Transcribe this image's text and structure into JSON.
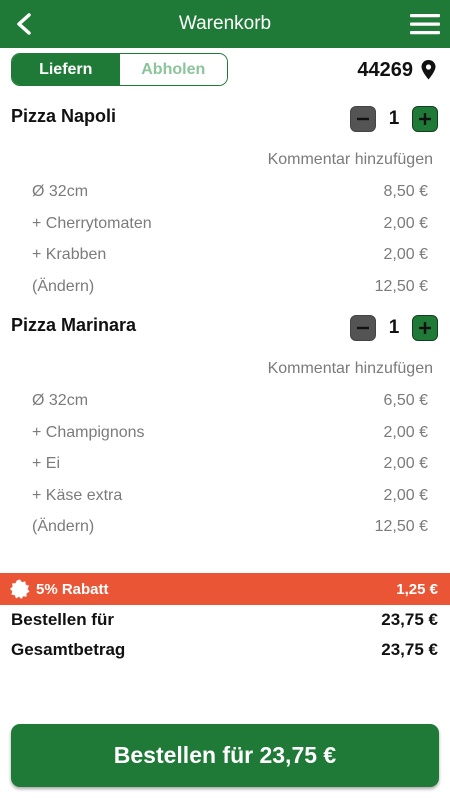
{
  "header": {
    "title": "Warenkorb",
    "back_icon": "chevron-left-icon",
    "menu_icon": "hamburger-menu-icon"
  },
  "delivery_toggle": {
    "options": [
      "Liefern",
      "Abholen"
    ],
    "selected": "Liefern"
  },
  "location": {
    "zip": "44269",
    "icon": "location-pin-icon"
  },
  "cart": [
    {
      "name": "Pizza Napoli",
      "quantity": "1",
      "comment_label": "Kommentar hinzufügen",
      "lines": [
        {
          "label": "Ø 32cm",
          "price": "8,50 €"
        },
        {
          "label": "+ Cherrytomaten",
          "price": "2,00 €"
        },
        {
          "label": "+ Krabben",
          "price": "2,00 €"
        },
        {
          "label": "(Ändern)",
          "price": "12,50 €"
        }
      ]
    },
    {
      "name": "Pizza Marinara",
      "quantity": "1",
      "comment_label": "Kommentar hinzufügen",
      "lines": [
        {
          "label": "Ø 32cm",
          "price": "6,50 €"
        },
        {
          "label": "+ Champignons",
          "price": "2,00 €"
        },
        {
          "label": "+ Ei",
          "price": "2,00 €"
        },
        {
          "label": "+ Käse extra",
          "price": "2,00 €"
        },
        {
          "label": "(Ändern)",
          "price": "12,50 €"
        }
      ]
    }
  ],
  "discount": {
    "label": "5% Rabatt",
    "amount": "1,25 €",
    "icon": "badge-icon",
    "color": "#ea5535"
  },
  "summary": {
    "order_for_label": "Bestellen für",
    "order_for_value": "23,75 €",
    "total_label": "Gesamtbetrag",
    "total_value": "23,75 €"
  },
  "order_button": {
    "label": "Bestellen für 23,75 €"
  },
  "colors": {
    "brand_green": "#1f7a37",
    "muted_text": "#7b7b7b",
    "discount_red": "#ea5535"
  }
}
